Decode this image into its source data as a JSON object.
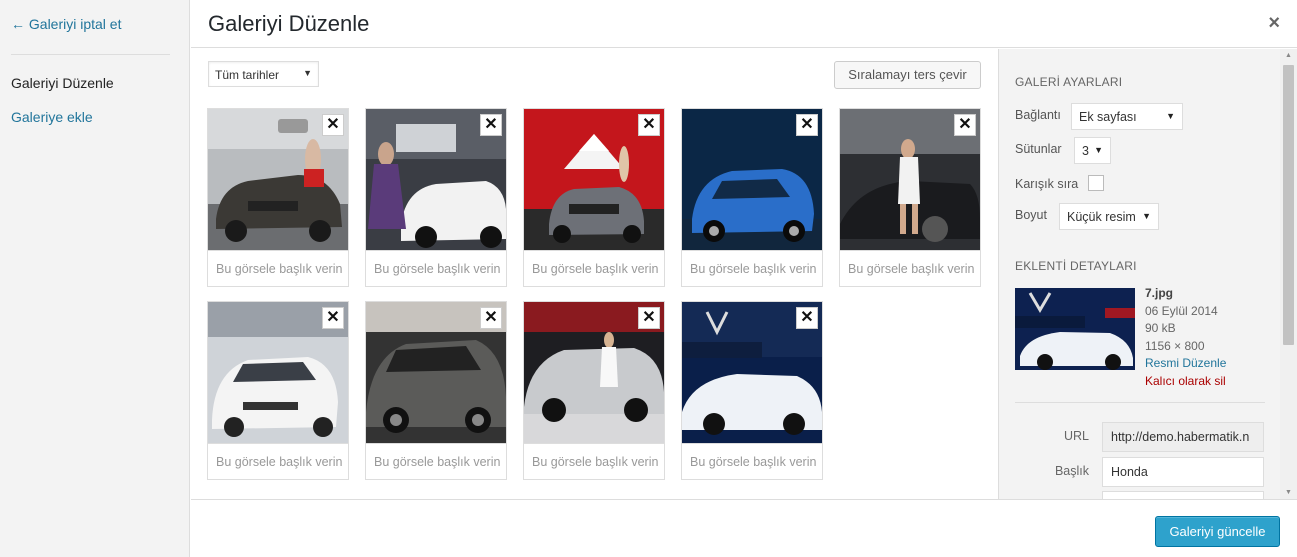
{
  "menu": {
    "cancel": "← Galeriyi iptal et",
    "items": [
      {
        "label": "Galeriyi Düzenle"
      },
      {
        "label": "Galeriye ekle"
      }
    ]
  },
  "header": {
    "title": "Galeriyi Düzenle",
    "close": "×"
  },
  "toolbar": {
    "date_filter": "Tüm tarihler",
    "reverse_button": "Sıralamayı ters çevir"
  },
  "gallery": {
    "caption_placeholder": "Bu görsele başlık verin",
    "remove_icon": "✕",
    "items": [
      {
        "alt": "car-1"
      },
      {
        "alt": "car-2"
      },
      {
        "alt": "car-3"
      },
      {
        "alt": "car-4"
      },
      {
        "alt": "car-5"
      },
      {
        "alt": "car-6"
      },
      {
        "alt": "car-7"
      },
      {
        "alt": "car-8"
      },
      {
        "alt": "car-9"
      }
    ]
  },
  "settings": {
    "heading": "GALERİ AYARLARI",
    "link_label": "Bağlantı",
    "link_value": "Ek sayfası",
    "columns_label": "Sütunlar",
    "columns_value": "3",
    "random_label": "Karışık sıra",
    "size_label": "Boyut",
    "size_value": "Küçük resim"
  },
  "attachment": {
    "heading": "EKLENTİ DETAYLARI",
    "filename": "7.jpg",
    "date": "06 Eylül 2014",
    "filesize": "90 kB",
    "dimensions": "1156 × 800",
    "edit_link": "Resmi Düzenle",
    "delete_link": "Kalıcı olarak sil",
    "url_label": "URL",
    "url_value": "http://demo.habermatik.n",
    "title_label": "Başlık",
    "title_value": "Honda"
  },
  "footer": {
    "update_button": "Galeriyi güncelle"
  },
  "colors": {
    "accent": "#2ea2cc",
    "link": "#21759b",
    "delete": "#aa0000"
  }
}
